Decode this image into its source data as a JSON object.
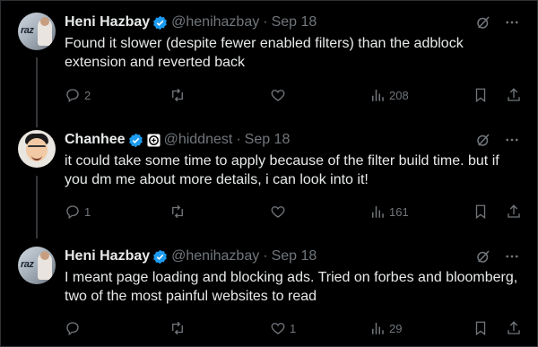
{
  "tweets": [
    {
      "name": "Heni Hazbay",
      "handle": "@henihazbay",
      "time": "Sep 18",
      "avatar_text": "raz",
      "text": "Found it slower (despite fewer enabled filters) than the adblock extension and reverted back",
      "replies": "2",
      "retweets": "",
      "likes": "",
      "views": "208"
    },
    {
      "name": "Chanhee",
      "handle": "@hiddnest",
      "time": "Sep 18",
      "text": "it could take some time to apply because of the filter build time. but if you dm me about more details, i can look into it!",
      "replies": "1",
      "retweets": "",
      "likes": "",
      "views": "161"
    },
    {
      "name": "Heni Hazbay",
      "handle": "@henihazbay",
      "time": "Sep 18",
      "avatar_text": "raz",
      "text": "I meant page loading and blocking ads. Tried on forbes and bloomberg, two of the most painful websites to read",
      "replies": "",
      "retweets": "",
      "likes": "1",
      "views": "29"
    }
  ],
  "colors": {
    "background": "#000000",
    "text": "#e7e9ea",
    "muted": "#71767b",
    "verified": "#1d9bf0"
  },
  "dot": "·"
}
